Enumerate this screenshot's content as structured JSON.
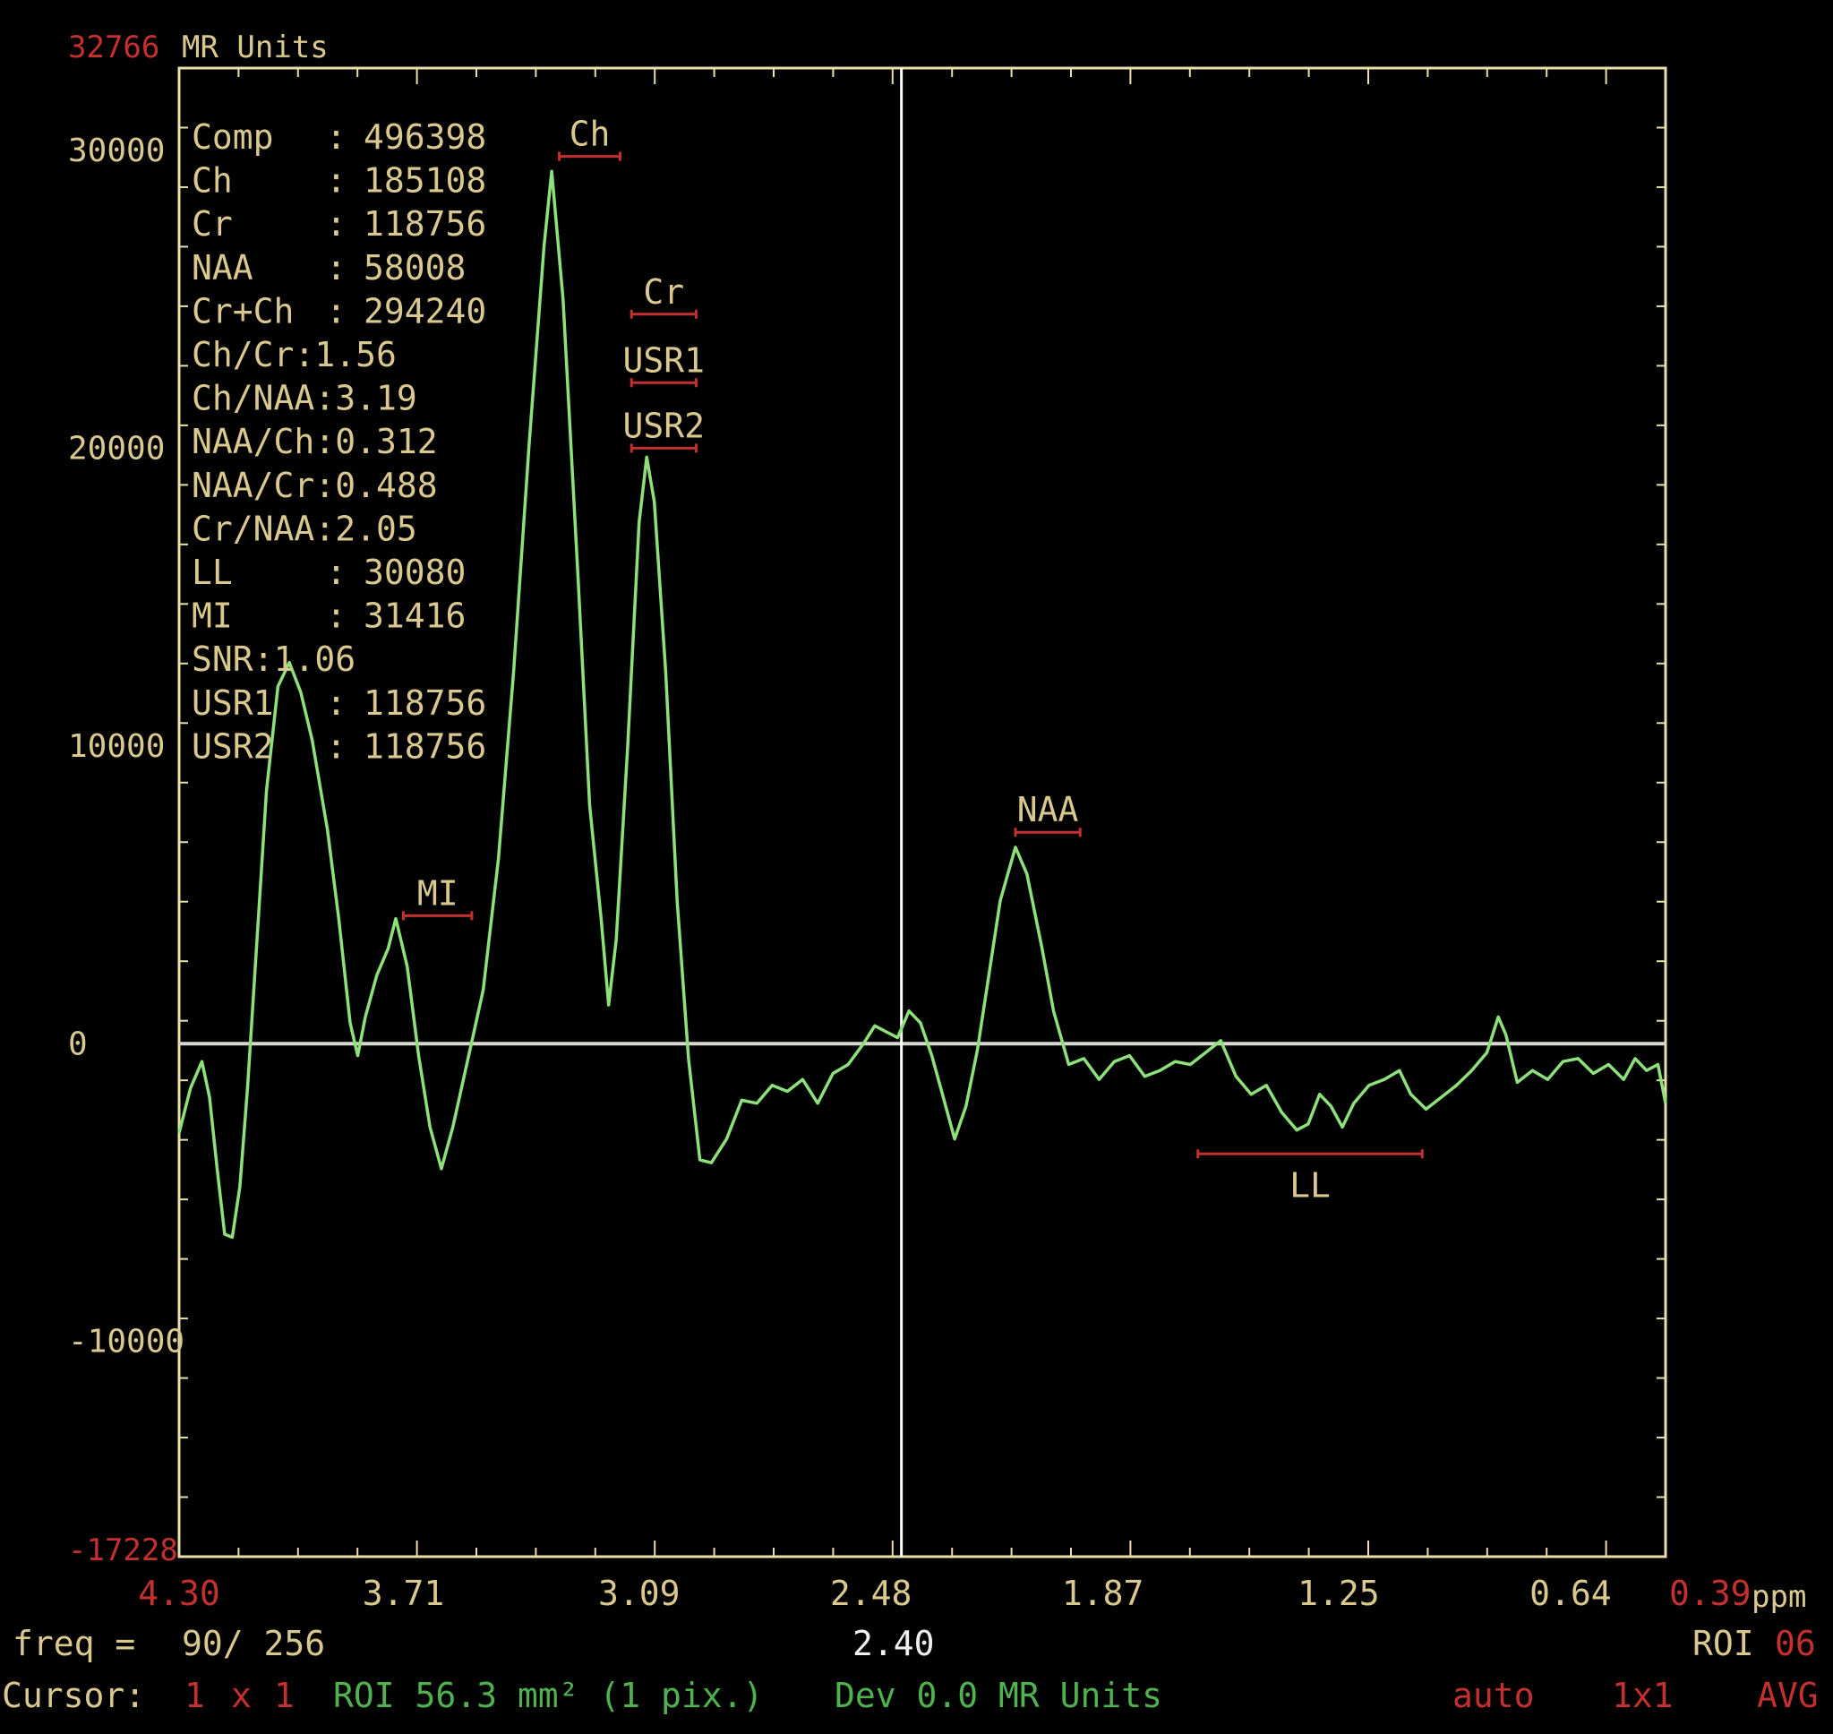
{
  "colors": {
    "background": "#000000",
    "axis": "#e9dfa8",
    "label_tan": "#d9c98f",
    "accent_red": "#c2302f",
    "spectrum_green": "#8ee07a",
    "text_green": "#4fb24f",
    "baseline": "#d8d8d0",
    "cursor_line": "#ffffff"
  },
  "header": {
    "max_value": "32766",
    "units": "MR Units"
  },
  "stats": [
    {
      "name": "Comp",
      "sep": ": ",
      "value": "496398"
    },
    {
      "name": "Ch",
      "sep": ": ",
      "value": "185108"
    },
    {
      "name": "Cr",
      "sep": ": ",
      "value": "118756"
    },
    {
      "name": "NAA",
      "sep": ": ",
      "value": "58008"
    },
    {
      "name": "Cr+Ch",
      "sep": ": ",
      "value": "294240"
    },
    {
      "name": "Ch/Cr",
      "sep": ":",
      "value": "1.56"
    },
    {
      "name": "Ch/NAA",
      "sep": ":",
      "value": "3.19"
    },
    {
      "name": "NAA/Ch",
      "sep": ":",
      "value": "0.312"
    },
    {
      "name": "NAA/Cr",
      "sep": ":",
      "value": "0.488"
    },
    {
      "name": "Cr/NAA",
      "sep": ":",
      "value": "2.05"
    },
    {
      "name": "LL",
      "sep": ": ",
      "value": "30080"
    },
    {
      "name": "MI",
      "sep": ": ",
      "value": "31416"
    },
    {
      "name": "SNR",
      "sep": ":",
      "value": "1.06"
    },
    {
      "name": "USR1",
      "sep": ": ",
      "value": "118756"
    },
    {
      "name": "USR2",
      "sep": ": ",
      "value": "118756"
    }
  ],
  "chart_data": {
    "type": "line",
    "xlabel": "ppm",
    "ylabel": "MR Units",
    "xlim": [
      4.3,
      0.39
    ],
    "ylim": [
      -17228,
      32766
    ],
    "x_reversed": true,
    "grid": false,
    "y_ticks": [
      {
        "value": 30000,
        "label": "30000"
      },
      {
        "value": 20000,
        "label": "20000"
      },
      {
        "value": 10000,
        "label": "10000"
      },
      {
        "value": 0,
        "label": "0"
      },
      {
        "value": -10000,
        "label": "-10000"
      }
    ],
    "y_min_label": "-17228",
    "x_tick_labels": [
      "3.71",
      "3.09",
      "2.48",
      "1.87",
      "1.25",
      "0.64"
    ],
    "x_ticks": [
      3.71,
      3.09,
      2.48,
      1.87,
      1.25,
      0.64
    ],
    "x_min_label": "4.30",
    "x_max_label": "0.39",
    "cursor_ppm": 2.4,
    "cursor_label": "2.40",
    "peak_markers": [
      {
        "label": "MI",
        "ppm_from": 3.71,
        "ppm_to": 3.53,
        "y": 4300,
        "label_side": "above"
      },
      {
        "label": "Ch",
        "ppm_from": 3.3,
        "ppm_to": 3.14,
        "y": 29800,
        "label_side": "above"
      },
      {
        "label": "Cr",
        "ppm_from": 3.11,
        "ppm_to": 2.94,
        "y": 24500,
        "label_side": "above"
      },
      {
        "label": "USR1",
        "ppm_from": 3.11,
        "ppm_to": 2.94,
        "y": 22200,
        "label_side": "above"
      },
      {
        "label": "USR2",
        "ppm_from": 3.11,
        "ppm_to": 2.94,
        "y": 20000,
        "label_side": "above"
      },
      {
        "label": "NAA",
        "ppm_from": 2.1,
        "ppm_to": 1.93,
        "y": 7100,
        "label_side": "above"
      },
      {
        "label": "LL",
        "ppm_from": 1.62,
        "ppm_to": 1.03,
        "y": -3700,
        "label_side": "below"
      }
    ],
    "series": [
      {
        "points": [
          [
            4.3,
            -3000
          ],
          [
            4.27,
            -1500
          ],
          [
            4.24,
            -600
          ],
          [
            4.22,
            -1800
          ],
          [
            4.2,
            -4200
          ],
          [
            4.18,
            -6400
          ],
          [
            4.16,
            -6500
          ],
          [
            4.14,
            -4800
          ],
          [
            4.12,
            -1500
          ],
          [
            4.1,
            2500
          ],
          [
            4.07,
            8500
          ],
          [
            4.04,
            12000
          ],
          [
            4.01,
            12800
          ],
          [
            3.98,
            11800
          ],
          [
            3.95,
            10200
          ],
          [
            3.91,
            7200
          ],
          [
            3.88,
            4200
          ],
          [
            3.85,
            700
          ],
          [
            3.83,
            -400
          ],
          [
            3.81,
            900
          ],
          [
            3.78,
            2300
          ],
          [
            3.75,
            3200
          ],
          [
            3.73,
            4200
          ],
          [
            3.7,
            2600
          ],
          [
            3.67,
            -400
          ],
          [
            3.64,
            -2800
          ],
          [
            3.61,
            -4200
          ],
          [
            3.58,
            -2800
          ],
          [
            3.54,
            -500
          ],
          [
            3.5,
            1800
          ],
          [
            3.46,
            6200
          ],
          [
            3.42,
            12500
          ],
          [
            3.38,
            20000
          ],
          [
            3.34,
            26800
          ],
          [
            3.32,
            29300
          ],
          [
            3.29,
            25000
          ],
          [
            3.25,
            15500
          ],
          [
            3.22,
            8000
          ],
          [
            3.19,
            4200
          ],
          [
            3.17,
            1300
          ],
          [
            3.15,
            3500
          ],
          [
            3.12,
            10000
          ],
          [
            3.09,
            17500
          ],
          [
            3.07,
            19700
          ],
          [
            3.05,
            18200
          ],
          [
            3.02,
            12500
          ],
          [
            2.99,
            4800
          ],
          [
            2.96,
            -500
          ],
          [
            2.93,
            -3900
          ],
          [
            2.9,
            -4000
          ],
          [
            2.86,
            -3200
          ],
          [
            2.82,
            -1900
          ],
          [
            2.78,
            -2000
          ],
          [
            2.74,
            -1400
          ],
          [
            2.7,
            -1600
          ],
          [
            2.66,
            -1200
          ],
          [
            2.62,
            -2000
          ],
          [
            2.58,
            -1000
          ],
          [
            2.54,
            -700
          ],
          [
            2.5,
            0
          ],
          [
            2.47,
            600
          ],
          [
            2.44,
            400
          ],
          [
            2.41,
            200
          ],
          [
            2.38,
            1100
          ],
          [
            2.35,
            700
          ],
          [
            2.32,
            -400
          ],
          [
            2.29,
            -1800
          ],
          [
            2.26,
            -3200
          ],
          [
            2.23,
            -2100
          ],
          [
            2.2,
            -200
          ],
          [
            2.17,
            2300
          ],
          [
            2.14,
            4800
          ],
          [
            2.1,
            6600
          ],
          [
            2.07,
            5700
          ],
          [
            2.03,
            3200
          ],
          [
            2.0,
            1100
          ],
          [
            1.96,
            -700
          ],
          [
            1.92,
            -500
          ],
          [
            1.88,
            -1200
          ],
          [
            1.84,
            -600
          ],
          [
            1.8,
            -400
          ],
          [
            1.76,
            -1100
          ],
          [
            1.72,
            -900
          ],
          [
            1.68,
            -600
          ],
          [
            1.64,
            -700
          ],
          [
            1.6,
            -300
          ],
          [
            1.56,
            100
          ],
          [
            1.52,
            -1100
          ],
          [
            1.48,
            -1700
          ],
          [
            1.44,
            -1400
          ],
          [
            1.4,
            -2300
          ],
          [
            1.36,
            -2900
          ],
          [
            1.33,
            -2700
          ],
          [
            1.3,
            -1700
          ],
          [
            1.27,
            -2100
          ],
          [
            1.24,
            -2800
          ],
          [
            1.21,
            -2000
          ],
          [
            1.17,
            -1400
          ],
          [
            1.13,
            -1200
          ],
          [
            1.09,
            -900
          ],
          [
            1.06,
            -1700
          ],
          [
            1.02,
            -2200
          ],
          [
            0.98,
            -1800
          ],
          [
            0.94,
            -1400
          ],
          [
            0.9,
            -900
          ],
          [
            0.86,
            -300
          ],
          [
            0.83,
            900
          ],
          [
            0.81,
            300
          ],
          [
            0.78,
            -1300
          ],
          [
            0.74,
            -900
          ],
          [
            0.7,
            -1200
          ],
          [
            0.66,
            -600
          ],
          [
            0.62,
            -500
          ],
          [
            0.58,
            -1000
          ],
          [
            0.54,
            -700
          ],
          [
            0.5,
            -1200
          ],
          [
            0.47,
            -500
          ],
          [
            0.44,
            -900
          ],
          [
            0.41,
            -700
          ],
          [
            0.39,
            -2000
          ]
        ]
      }
    ]
  },
  "footer": {
    "freq_label": "freq =",
    "freq_value": "90/ 256",
    "roi_right_label": "ROI",
    "roi_right_value": "06",
    "cursor_label": "Cursor:",
    "cursor_a": "1",
    "cursor_x": "x",
    "cursor_b": "1",
    "roi_info": "ROI 56.3 mm² (1 pix.)",
    "dev_info": "Dev 0.0 MR Units",
    "mode_auto": "auto",
    "mode_grid": "1x1",
    "mode_avg": "AVG"
  }
}
